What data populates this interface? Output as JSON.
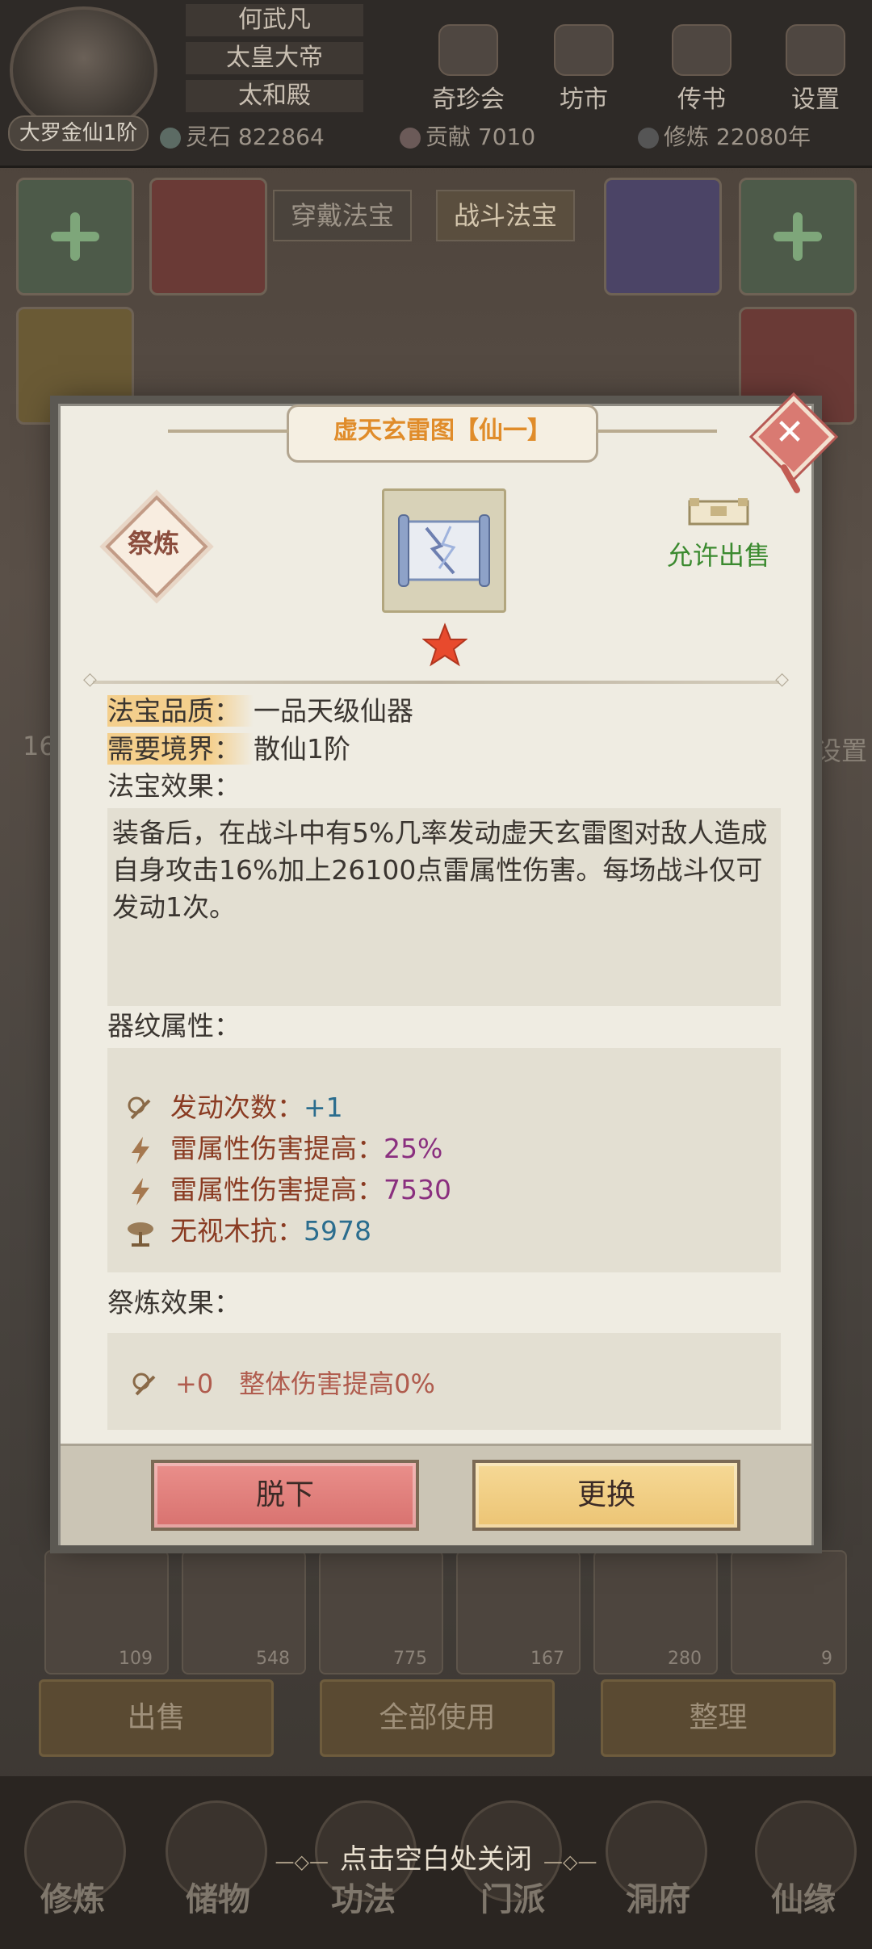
{
  "header": {
    "player_rank": "大罗金仙1阶",
    "names": [
      "何武凡",
      "太皇大帝",
      "太和殿"
    ],
    "menu": [
      "奇珍会",
      "坊市",
      "传书",
      "设置"
    ],
    "resources": {
      "spirit_stone": "灵石 822864",
      "contribution": "贡献 7010",
      "cultivation": "修炼 22080年"
    }
  },
  "tabs": [
    "穿戴法宝",
    "战斗法宝"
  ],
  "side": {
    "left_number": "16",
    "right_label": "设置"
  },
  "inventory_counts": [
    "109",
    "548",
    "775",
    "167",
    "280",
    "9"
  ],
  "actions": [
    "出售",
    "全部使用",
    "整理"
  ],
  "bottom_nav": [
    "修炼",
    "储物",
    "功法",
    "门派",
    "洞府",
    "仙缘"
  ],
  "close_hint": "点击空白处关闭",
  "dialog": {
    "title": "虚天玄雷图【仙一】",
    "refine_button": "祭炼",
    "sell_status": "允许出售",
    "stars": 1,
    "quality_label": "法宝品质：",
    "quality_value": "一品天级仙器",
    "realm_label": "需要境界：",
    "realm_value": "散仙1阶",
    "effect_label": "法宝效果：",
    "effect_text": "装备后，在战斗中有5%几率发动虚天玄雷图对敌人造成自身攻击16%加上26100点雷属性伤害。每场战斗仅可发动1次。",
    "attr_label": "器纹属性：",
    "attributes": [
      {
        "icon": "cast-count-icon",
        "label": "发动次数：",
        "value": "+1"
      },
      {
        "icon": "lightning-icon",
        "label": "雷属性伤害提高：",
        "value": "25%"
      },
      {
        "icon": "lightning-icon",
        "label": "雷属性伤害提高：",
        "value": "7530"
      },
      {
        "icon": "tree-icon",
        "label": "无视木抗：",
        "value": "5978"
      }
    ],
    "refine_effect_label": "祭炼效果：",
    "refine_effect": {
      "level": "+0",
      "text": "整体伤害提高0%"
    },
    "unequip_button": "脱下",
    "replace_button": "更换"
  }
}
